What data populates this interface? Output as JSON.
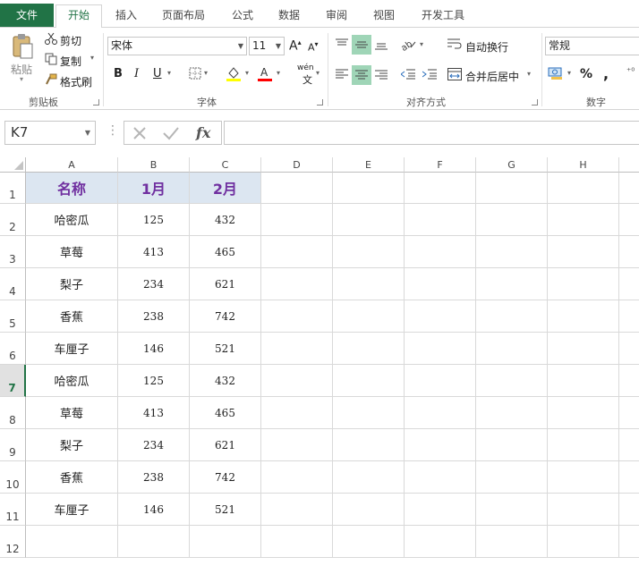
{
  "tabs": [
    "文件",
    "开始",
    "插入",
    "页面布局",
    "公式",
    "数据",
    "审阅",
    "视图",
    "开发工具"
  ],
  "ribbon": {
    "clipboard": {
      "paste": "粘贴",
      "cut": "剪切",
      "copy": "复制",
      "format_painter": "格式刷",
      "label": "剪贴板"
    },
    "font": {
      "name": "宋体",
      "size": "11",
      "bold": "B",
      "italic": "I",
      "underline": "U",
      "grow": "A",
      "shrink": "A",
      "phonetic": "wén",
      "label": "字体"
    },
    "alignment": {
      "wrap": "自动换行",
      "merge": "合并后居中",
      "label": "对齐方式"
    },
    "number": {
      "format": "常规",
      "percent": "%",
      "comma": ",",
      "label": "数字"
    }
  },
  "formula_bar": {
    "name_box": "K7",
    "fx": "fx",
    "formula": ""
  },
  "columns": [
    "A",
    "B",
    "C",
    "D",
    "E",
    "F",
    "G",
    "H"
  ],
  "rows": [
    "1",
    "2",
    "3",
    "4",
    "5",
    "6",
    "7",
    "8",
    "9",
    "10",
    "11",
    "12"
  ],
  "selected_row": "7",
  "table": {
    "headers": [
      "名称",
      "1月",
      "2月"
    ],
    "data": [
      [
        "哈密瓜",
        "125",
        "432"
      ],
      [
        "草莓",
        "413",
        "465"
      ],
      [
        "梨子",
        "234",
        "621"
      ],
      [
        "香蕉",
        "238",
        "742"
      ],
      [
        "车厘子",
        "146",
        "521"
      ],
      [
        "哈密瓜",
        "125",
        "432"
      ],
      [
        "草莓",
        "413",
        "465"
      ],
      [
        "梨子",
        "234",
        "621"
      ],
      [
        "香蕉",
        "238",
        "742"
      ],
      [
        "车厘子",
        "146",
        "521"
      ]
    ]
  },
  "colors": {
    "accent": "#217346",
    "header_fill": "#dce6f1",
    "header_text": "#7030a0"
  }
}
